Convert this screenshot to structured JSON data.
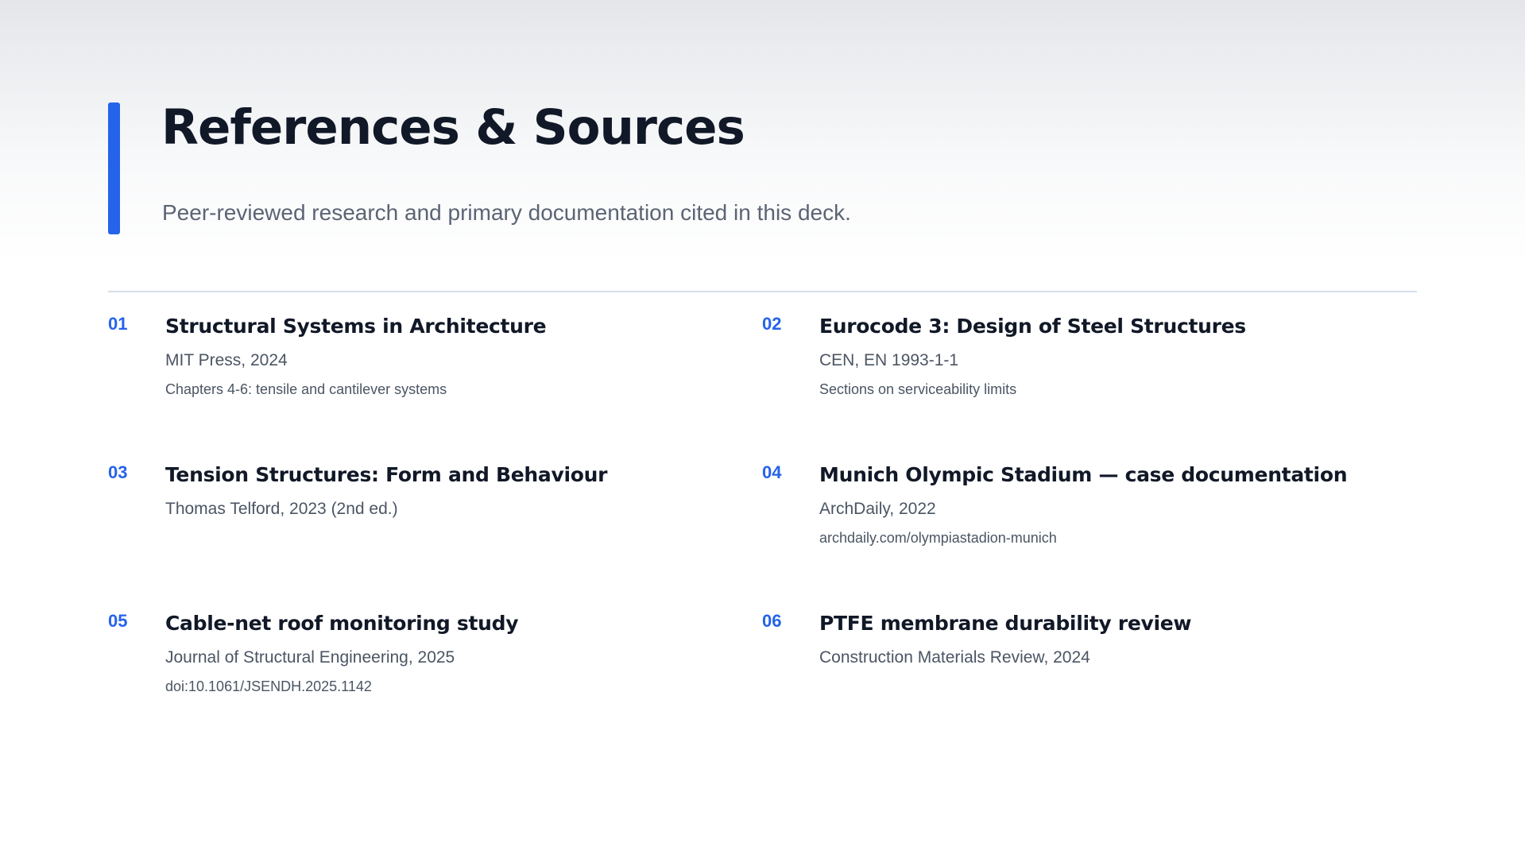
{
  "header": {
    "title": "References & Sources",
    "subtitle": "Peer-reviewed research and primary documentation cited in this deck."
  },
  "references": [
    {
      "num": "01",
      "title": "Structural Systems in Architecture",
      "meta": "MIT Press, 2024",
      "note": "Chapters 4-6: tensile and cantilever systems"
    },
    {
      "num": "02",
      "title": "Eurocode 3: Design of Steel Structures",
      "meta": "CEN, EN 1993-1-1",
      "note": "Sections on serviceability limits"
    },
    {
      "num": "03",
      "title": "Tension Structures: Form and Behaviour",
      "meta": "Thomas Telford, 2023 (2nd ed.)",
      "note": ""
    },
    {
      "num": "04",
      "title": "Munich Olympic Stadium — case documentation",
      "meta": "ArchDaily, 2022",
      "note": "archdaily.com/olympiastadion-munich"
    },
    {
      "num": "05",
      "title": "Cable-net roof monitoring study",
      "meta": "Journal of Structural Engineering, 2025",
      "note": "doi:10.1061/JSENDH.2025.1142"
    },
    {
      "num": "06",
      "title": "PTFE membrane durability review",
      "meta": "Construction Materials Review, 2024",
      "note": ""
    }
  ],
  "colors": {
    "accent": "#2563eb",
    "title": "#111827",
    "subtitle": "#5b6474",
    "meta": "#4b5563",
    "note": "#4b5563",
    "divider": "#d5deea"
  }
}
